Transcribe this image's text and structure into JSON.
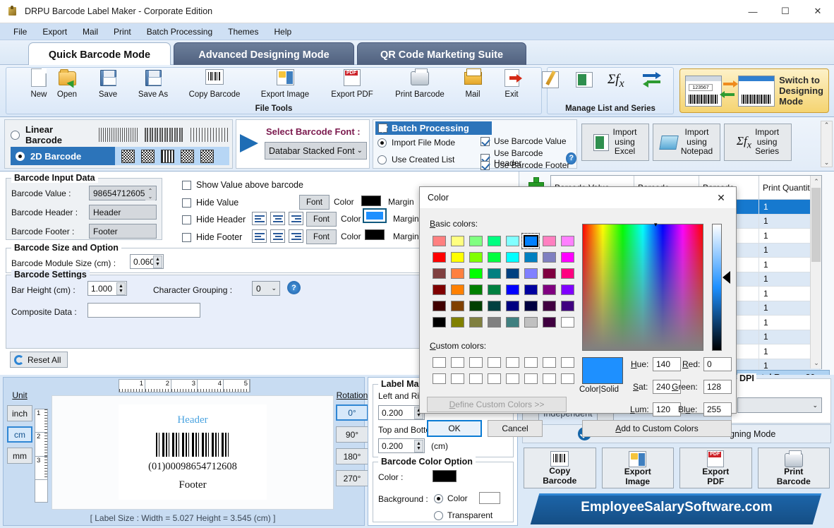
{
  "window": {
    "title": "DRPU Barcode Label Maker - Corporate Edition",
    "minimize": "—",
    "maximize": "☐",
    "close": "✕"
  },
  "menu": {
    "items": [
      "File",
      "Export",
      "Mail",
      "Print",
      "Batch Processing",
      "Themes",
      "Help"
    ]
  },
  "tabs": [
    {
      "label": "Quick Barcode Mode",
      "active": true
    },
    {
      "label": "Advanced Designing Mode",
      "active": false
    },
    {
      "label": "QR Code Marketing Suite",
      "active": false
    }
  ],
  "ribbon": {
    "file_tools_title": "File Tools",
    "manage_title": "Manage List and Series",
    "file_buttons": [
      {
        "label": "New",
        "icon": "new-page-icon"
      },
      {
        "label": "Open",
        "icon": "open-folder-icon"
      },
      {
        "label": "Save",
        "icon": "save-disk-icon"
      },
      {
        "label": "Save As",
        "icon": "save-as-disk-icon"
      },
      {
        "label": "Copy Barcode",
        "icon": "copy-barcode-icon"
      },
      {
        "label": "Export Image",
        "icon": "export-image-icon"
      },
      {
        "label": "Export PDF",
        "icon": "export-pdf-icon"
      },
      {
        "label": "Print Barcode",
        "icon": "printer-icon"
      },
      {
        "label": "Mail",
        "icon": "mail-icon"
      },
      {
        "label": "Exit",
        "icon": "exit-icon"
      }
    ],
    "switch_mode": {
      "line1": "Switch to",
      "line2": "Designing",
      "line3": "Mode",
      "code": "123567"
    }
  },
  "barcode_type": {
    "linear_label": "Linear Barcode",
    "twod_label": "2D Barcode",
    "linear_selected": false,
    "twod_selected": true
  },
  "font_select": {
    "title": "Select Barcode Font :",
    "value": "Databar Stacked Font",
    "chevron": "⌄"
  },
  "batch": {
    "title": "Batch Processing",
    "title_checked": true,
    "import_file_mode": "Import File Mode",
    "use_created_list": "Use Created List",
    "mode_selected": "Import File Mode",
    "checks": [
      {
        "label": "Use Barcode Value",
        "checked": true
      },
      {
        "label": "Use Barcode Header",
        "checked": true
      },
      {
        "label": "Use Barcode Footer",
        "checked": true
      }
    ],
    "help": "?",
    "import_buttons": [
      {
        "l1": "Import",
        "l2": "using",
        "l3": "Excel",
        "icon": "excel-icon"
      },
      {
        "l1": "Import",
        "l2": "using",
        "l3": "Notepad",
        "icon": "notepad-icon"
      },
      {
        "l1": "Import",
        "l2": "using",
        "l3": "Series",
        "icon": "sigma-fx-icon"
      }
    ]
  },
  "input_panel": {
    "group_title": "Barcode Input Data",
    "value_label": "Barcode Value :",
    "value": "98654712605",
    "header_label": "Barcode Header :",
    "header": "Header",
    "footer_label": "Barcode Footer :",
    "footer": "Footer",
    "options": [
      {
        "label": "Show Value above barcode",
        "checked": false
      },
      {
        "label": "Hide Value",
        "checked": false
      },
      {
        "label": "Hide Header",
        "checked": false
      },
      {
        "label": "Hide Footer",
        "checked": false
      }
    ],
    "font_btn": "Font",
    "color_label": "Color",
    "margin_label": "Margin",
    "value_color": "#000000",
    "header_color": "#1e90ff",
    "footer_color": "#000000"
  },
  "size_panel": {
    "group_title": "Barcode Size and Option",
    "module_label": "Barcode Module Size (cm) :",
    "module_value": "0.060"
  },
  "settings_panel": {
    "group_title": "Barcode Settings",
    "bar_height_label": "Bar Height (cm) :",
    "bar_height": "1.000",
    "char_group_label": "Character Grouping :",
    "char_group": "0",
    "composite_label": "Composite Data :",
    "composite_value": "",
    "help": "?"
  },
  "reset": {
    "label": "Reset All",
    "icon": "refresh-icon"
  },
  "grid": {
    "add_icon": "plus-icon",
    "columns": [
      "Barcode Value",
      "Barcode",
      "Barcode",
      "Print Quantity"
    ],
    "rows": [
      {
        "qty": "1",
        "selected": true
      },
      {
        "qty": "1",
        "selected": false
      },
      {
        "qty": "1",
        "selected": false
      },
      {
        "qty": "1",
        "selected": false
      },
      {
        "qty": "1",
        "selected": false
      },
      {
        "qty": "1",
        "selected": false
      },
      {
        "qty": "1",
        "selected": false
      },
      {
        "qty": "1",
        "selected": false
      },
      {
        "qty": "1",
        "selected": false
      },
      {
        "qty": "1",
        "selected": false
      },
      {
        "qty": "1",
        "selected": false
      },
      {
        "qty": "1",
        "selected": false
      }
    ],
    "total_rows": "Total Rows : 20",
    "scroll_up": "⌃",
    "scroll_down": "⌄"
  },
  "preview": {
    "unit_label": "Unit",
    "units": [
      {
        "label": "inch",
        "active": false
      },
      {
        "label": "cm",
        "active": true
      },
      {
        "label": "mm",
        "active": false
      }
    ],
    "h_ruler": [
      "1",
      "2",
      "3",
      "4",
      "5"
    ],
    "v_ruler": [
      "1",
      "2",
      "3"
    ],
    "label_header": "Header",
    "label_value": "(01)00098654712608",
    "label_footer": "Footer",
    "size_text": "[ Label Size : Width = 5.027  Height = 3.545 (cm) ]",
    "rotation_label": "Rotation",
    "rotations": [
      {
        "label": "0°",
        "active": true
      },
      {
        "label": "90°",
        "active": false
      },
      {
        "label": "180°",
        "active": false
      },
      {
        "label": "270°",
        "active": false
      }
    ]
  },
  "margin_panel": {
    "group_title": "Label Margin",
    "left_right_label": "Left and Right Margin :",
    "left_right": "0.200",
    "top_bottom_label": "Top and Bottom Margin :",
    "top_bottom": "0.200",
    "unit": "(cm)"
  },
  "color_option_panel": {
    "group_title": "Barcode Color Option",
    "color_label": "Color :",
    "color": "#000000",
    "background_label": "Background :",
    "bg_color_option": "Color",
    "bg_transparent_option": "Transparent",
    "bg_selected": "Color",
    "bg_color": "#ffffff"
  },
  "right_bottom": {
    "dpi_title": "DPI",
    "dpi_value": "",
    "independent_label": "Independent",
    "use_advance": "Use this Barcode in Advance Designing Mode",
    "action_buttons": [
      {
        "l1": "Copy",
        "l2": "Barcode",
        "icon": "copy-barcode-icon"
      },
      {
        "l1": "Export",
        "l2": "Image",
        "icon": "export-image-icon"
      },
      {
        "l1": "Export",
        "l2": "PDF",
        "icon": "export-pdf-icon"
      },
      {
        "l1": "Print",
        "l2": "Barcode",
        "icon": "printer-icon"
      }
    ],
    "footer_brand": "EmployeeSalarySoftware.com"
  },
  "color_dialog": {
    "title": "Color",
    "close": "✕",
    "basic_label": "Basic colors:",
    "custom_label": "Custom colors:",
    "define_custom": "Define Custom Colors >>",
    "ok": "OK",
    "cancel": "Cancel",
    "add_to_custom": "Add to Custom Colors",
    "color_solid_label": "Color|Solid",
    "selected_color": "#1e90ff",
    "fields": {
      "hue_label": "Hue:",
      "hue": "140",
      "sat_label": "Sat:",
      "sat": "240",
      "lum_label": "Lum:",
      "lum": "120",
      "red_label": "Red:",
      "red": "0",
      "green_label": "Green:",
      "green": "128",
      "blue_label": "Blue:",
      "blue": "255"
    },
    "picked_index": 5,
    "basic_colors": [
      "#ff8080",
      "#ffff80",
      "#80ff80",
      "#00ff80",
      "#80ffff",
      "#0080ff",
      "#ff80c0",
      "#ff80ff",
      "#ff0000",
      "#ffff00",
      "#80ff00",
      "#00ff40",
      "#00ffff",
      "#0080c0",
      "#8080c0",
      "#ff00ff",
      "#804040",
      "#ff8040",
      "#00ff00",
      "#008080",
      "#004080",
      "#8080ff",
      "#800040",
      "#ff0080",
      "#800000",
      "#ff8000",
      "#008000",
      "#008040",
      "#0000ff",
      "#0000a0",
      "#800080",
      "#8000ff",
      "#400000",
      "#804000",
      "#004000",
      "#004040",
      "#000080",
      "#000040",
      "#400040",
      "#400080",
      "#000000",
      "#808000",
      "#808040",
      "#808080",
      "#408080",
      "#c0c0c0",
      "#400040",
      "#ffffff"
    ],
    "custom_colors": [
      "#ffffff",
      "#ffffff",
      "#ffffff",
      "#ffffff",
      "#ffffff",
      "#ffffff",
      "#ffffff",
      "#ffffff",
      "#ffffff",
      "#ffffff",
      "#ffffff",
      "#ffffff",
      "#ffffff",
      "#ffffff",
      "#ffffff",
      "#ffffff"
    ]
  }
}
